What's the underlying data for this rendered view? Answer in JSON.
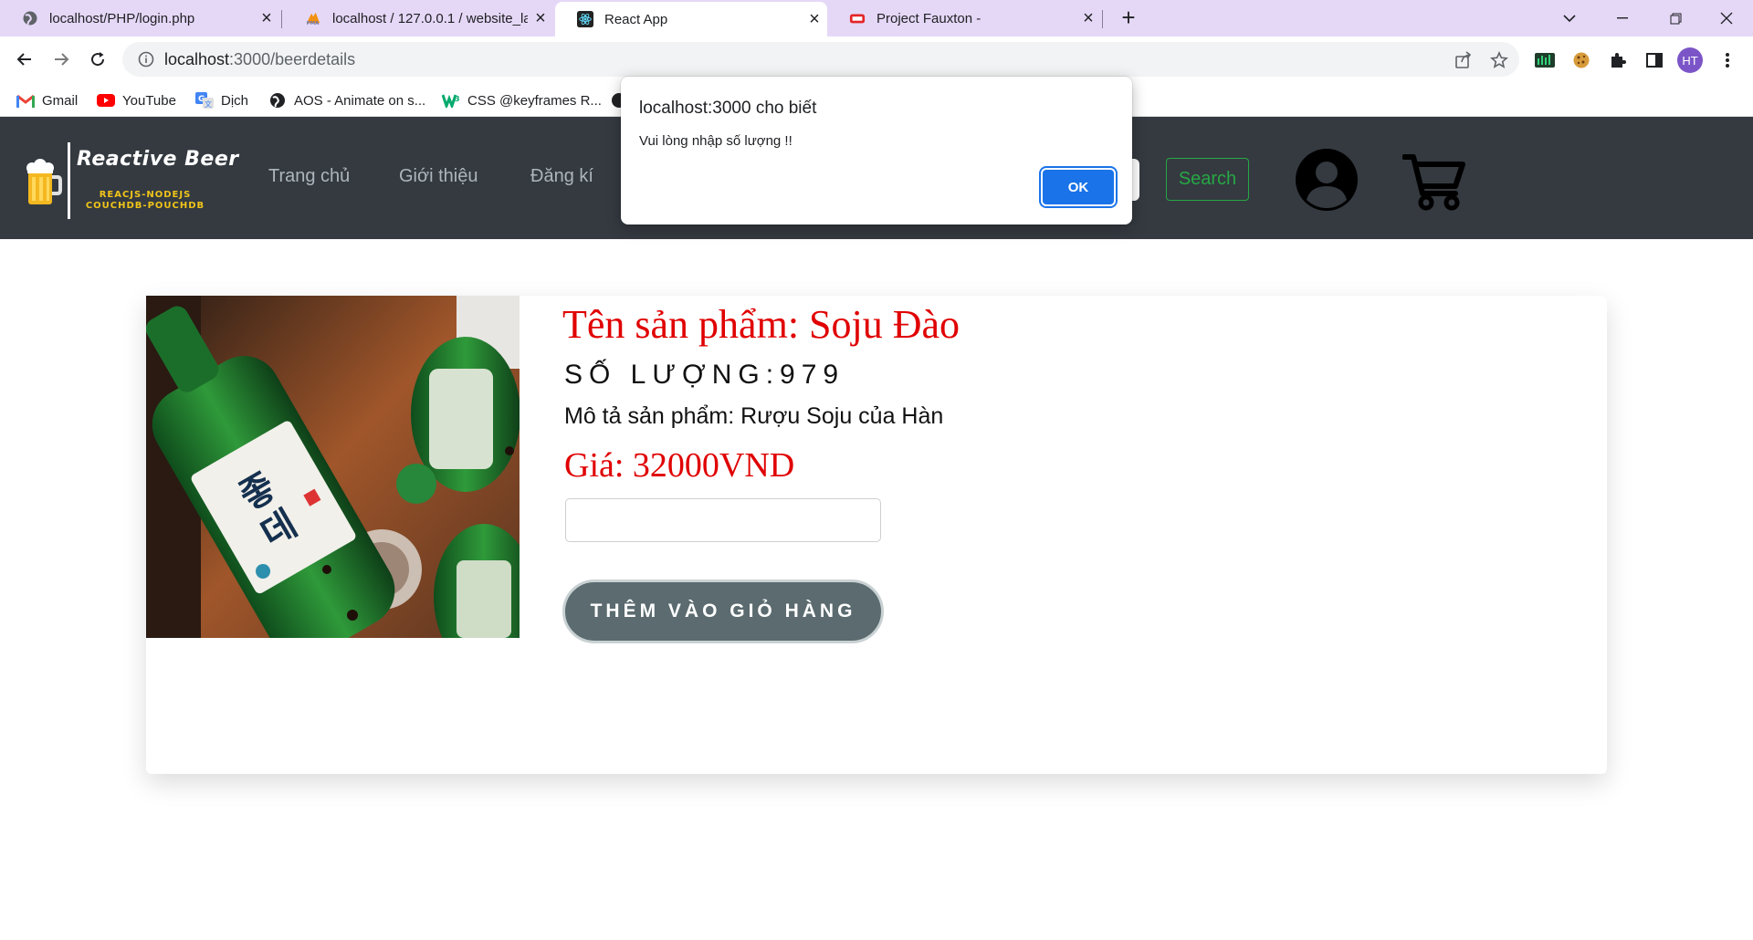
{
  "browser": {
    "tabs": [
      {
        "title": "localhost/PHP/login.php",
        "favicon": "globe-icon"
      },
      {
        "title": "localhost / 127.0.0.1 / website_la",
        "favicon": "phpmyadmin-icon"
      },
      {
        "title": "React App",
        "favicon": "react-icon"
      },
      {
        "title": "Project Fauxton -",
        "favicon": "couch-icon"
      }
    ],
    "active_tab": 2,
    "url_host": "localhost",
    "url_path": ":3000/beerdetails",
    "profile_initials": "HT",
    "bookmarks": [
      {
        "label": "Gmail",
        "icon": "gmail-icon"
      },
      {
        "label": "YouTube",
        "icon": "youtube-icon"
      },
      {
        "label": "Dịch",
        "icon": "translate-icon"
      },
      {
        "label": "AOS - Animate on s...",
        "icon": "globe-icon"
      },
      {
        "label": "CSS @keyframes R...",
        "icon": "w3schools-icon"
      }
    ]
  },
  "app": {
    "brand": {
      "title": "Reactive Beer",
      "subtitle_line1": "REACJS-NODEJS",
      "subtitle_line2": "COUCHDB-POUCHDB"
    },
    "nav": [
      "Trang chủ",
      "Giới thiệu",
      "Đăng kí"
    ],
    "search_label": "Search"
  },
  "product": {
    "name": "Tên sản phẩm: Soju Đào",
    "quantity": "SỐ LƯỢNG:979",
    "description": "Mô tả sản phẩm: Rượu Soju của Hàn",
    "price": "Giá: 32000VND",
    "quantity_input_value": "",
    "add_to_cart_label": "THÊM VÀO GIỎ HÀNG"
  },
  "dialog": {
    "title": "localhost:3000 cho biết",
    "message": "Vui lòng nhập số lượng !!",
    "ok_label": "OK"
  },
  "colors": {
    "tab_strip": "#e5d8f7",
    "navbar": "#343a40",
    "product_red": "#e00000",
    "search_green": "#28a745",
    "button_slate": "#5b6b6f",
    "dialog_blue": "#1a73e8"
  }
}
